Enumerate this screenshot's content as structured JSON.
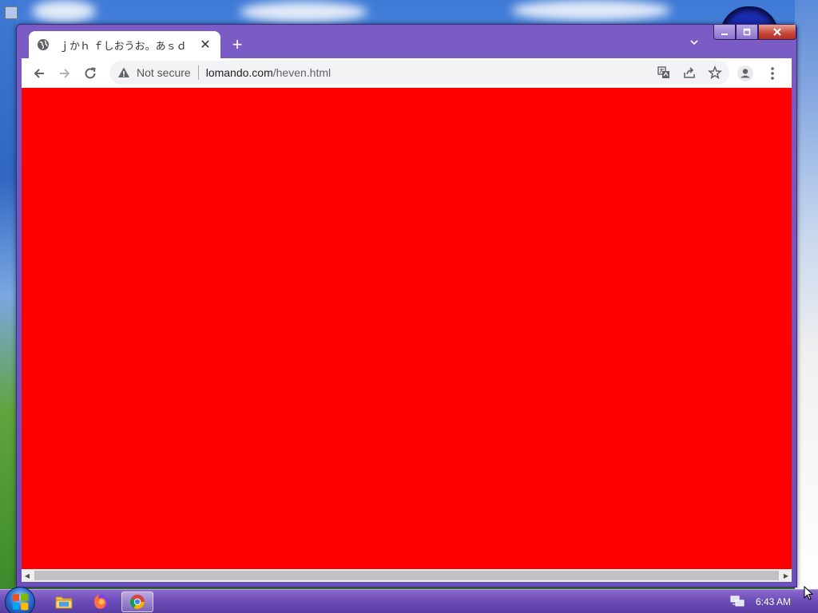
{
  "browser": {
    "tab": {
      "title": "ｊかｈ ｆしおうお。あｓｄ",
      "close_glyph": "✕",
      "favicon": "globe-icon"
    },
    "new_tab_glyph": "+",
    "tab_search_glyph": "⌄",
    "caption": {
      "minimize": "—",
      "maximize": "▢",
      "close": "✕"
    },
    "toolbar": {
      "back": "back-arrow-icon",
      "forward": "forward-arrow-icon",
      "reload": "reload-icon"
    },
    "address": {
      "security_text": "Not secure",
      "host": "lomando.com",
      "path": "/heven.html"
    },
    "omnibox_icons": [
      "translate-icon",
      "share-icon",
      "bookmark-star-icon"
    ],
    "page_background": "#ff0000"
  },
  "taskbar": {
    "apps": [
      "file-explorer-icon",
      "firefox-icon",
      "chrome-icon"
    ],
    "active_app": "chrome",
    "clock": "6:43 AM"
  },
  "colors": {
    "window_frame": "#7a5cc4",
    "content": "#ff0000",
    "taskbar": "#6a4bb5"
  }
}
